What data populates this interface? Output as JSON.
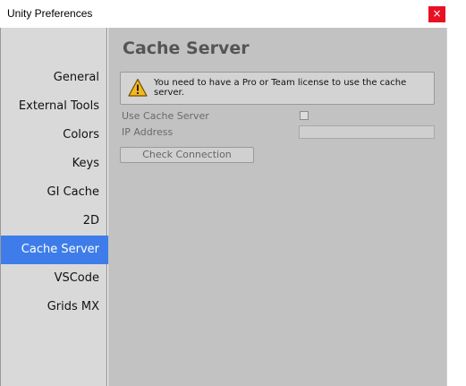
{
  "window": {
    "title": "Unity Preferences",
    "close_label": "×"
  },
  "sidebar": {
    "items": [
      {
        "label": "General"
      },
      {
        "label": "External Tools"
      },
      {
        "label": "Colors"
      },
      {
        "label": "Keys"
      },
      {
        "label": "GI Cache"
      },
      {
        "label": "2D"
      },
      {
        "label": "Cache Server"
      },
      {
        "label": "VSCode"
      },
      {
        "label": "Grids MX"
      }
    ],
    "selected": "Cache Server"
  },
  "main": {
    "title": "Cache Server",
    "help_message": "You need to have a Pro or Team license to use the cache server.",
    "use_cache_server_label": "Use Cache Server",
    "use_cache_server_checked": false,
    "ip_address_label": "IP Address",
    "ip_address_value": "",
    "check_connection_label": "Check Connection"
  },
  "colors": {
    "selected_item": "#3e7de9",
    "close_button": "#e81123",
    "panel_background": "#c2c2c2",
    "sidebar_background": "#d9d9d9"
  },
  "icons": {
    "warning": "warning-icon",
    "close": "close-icon"
  }
}
